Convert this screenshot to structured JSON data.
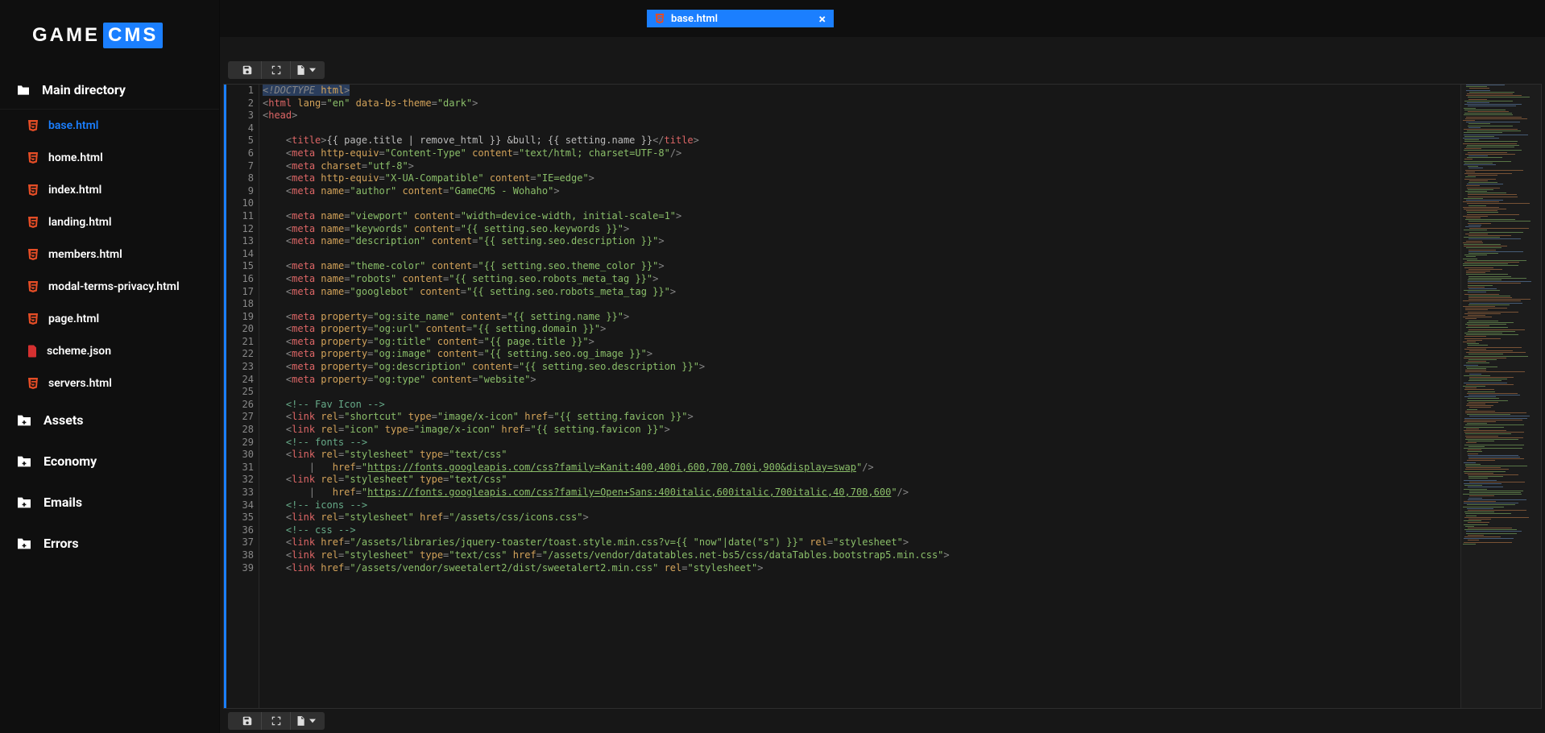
{
  "logo": {
    "part1": "GAME",
    "part2": "CMS"
  },
  "tree_header": "Main directory",
  "files": [
    {
      "name": "base.html",
      "type": "html",
      "active": true
    },
    {
      "name": "home.html",
      "type": "html"
    },
    {
      "name": "index.html",
      "type": "html"
    },
    {
      "name": "landing.html",
      "type": "html"
    },
    {
      "name": "members.html",
      "type": "html"
    },
    {
      "name": "modal-terms-privacy.html",
      "type": "html"
    },
    {
      "name": "page.html",
      "type": "html"
    },
    {
      "name": "scheme.json",
      "type": "json"
    },
    {
      "name": "servers.html",
      "type": "html"
    }
  ],
  "folders": [
    "Assets",
    "Economy",
    "Emails",
    "Errors"
  ],
  "tab": {
    "label": "base.html"
  },
  "code_lines": [
    {
      "n": 1,
      "indent": 0,
      "html": "<span class='t-sel'><span class='t-p'>&lt;</span><span class='t-doctype'>!DOCTYPE</span> <span class='t-attr'>html</span><span class='t-p'>&gt;</span></span>"
    },
    {
      "n": 2,
      "indent": 0,
      "html": "<span class='t-p'>&lt;</span><span class='t-tag'>html</span> <span class='t-attr'>lang</span><span class='t-p'>=</span><span class='t-str'>\"en\"</span> <span class='t-attr'>data-bs-theme</span><span class='t-p'>=</span><span class='t-str'>\"dark\"</span><span class='t-p'>&gt;</span>"
    },
    {
      "n": 3,
      "indent": 0,
      "html": "<span class='t-p'>&lt;</span><span class='t-tag'>head</span><span class='t-p'>&gt;</span>"
    },
    {
      "n": 4,
      "indent": 0,
      "html": ""
    },
    {
      "n": 5,
      "indent": 1,
      "html": "<span class='t-p'>&lt;</span><span class='t-tag'>title</span><span class='t-p'>&gt;</span>{{ page.title | remove_html }} &amp;bull; {{ setting.name }}<span class='t-p'>&lt;/</span><span class='t-tag'>title</span><span class='t-p'>&gt;</span>"
    },
    {
      "n": 6,
      "indent": 1,
      "html": "<span class='t-p'>&lt;</span><span class='t-tag'>meta</span> <span class='t-attr'>http-equiv</span><span class='t-p'>=</span><span class='t-str'>\"Content-Type\"</span> <span class='t-attr'>content</span><span class='t-p'>=</span><span class='t-str'>\"text/html; charset=UTF-8\"</span><span class='t-p'>/&gt;</span>"
    },
    {
      "n": 7,
      "indent": 1,
      "html": "<span class='t-p'>&lt;</span><span class='t-tag'>meta</span> <span class='t-attr'>charset</span><span class='t-p'>=</span><span class='t-str'>\"utf-8\"</span><span class='t-p'>&gt;</span>"
    },
    {
      "n": 8,
      "indent": 1,
      "html": "<span class='t-p'>&lt;</span><span class='t-tag'>meta</span> <span class='t-attr'>http-equiv</span><span class='t-p'>=</span><span class='t-str'>\"X-UA-Compatible\"</span> <span class='t-attr'>content</span><span class='t-p'>=</span><span class='t-str'>\"IE=edge\"</span><span class='t-p'>&gt;</span>"
    },
    {
      "n": 9,
      "indent": 1,
      "html": "<span class='t-p'>&lt;</span><span class='t-tag'>meta</span> <span class='t-attr'>name</span><span class='t-p'>=</span><span class='t-str'>\"author\"</span> <span class='t-attr'>content</span><span class='t-p'>=</span><span class='t-str'>\"GameCMS - Wohaho\"</span><span class='t-p'>&gt;</span>"
    },
    {
      "n": 10,
      "indent": 0,
      "html": ""
    },
    {
      "n": 11,
      "indent": 1,
      "html": "<span class='t-p'>&lt;</span><span class='t-tag'>meta</span> <span class='t-attr'>name</span><span class='t-p'>=</span><span class='t-str'>\"viewport\"</span> <span class='t-attr'>content</span><span class='t-p'>=</span><span class='t-str'>\"width=device-width, initial-scale=1\"</span><span class='t-p'>&gt;</span>"
    },
    {
      "n": 12,
      "indent": 1,
      "html": "<span class='t-p'>&lt;</span><span class='t-tag'>meta</span> <span class='t-attr'>name</span><span class='t-p'>=</span><span class='t-str'>\"keywords\"</span> <span class='t-attr'>content</span><span class='t-p'>=</span><span class='t-str'>\"{{ setting.seo.keywords }}\"</span><span class='t-p'>&gt;</span>"
    },
    {
      "n": 13,
      "indent": 1,
      "html": "<span class='t-p'>&lt;</span><span class='t-tag'>meta</span> <span class='t-attr'>name</span><span class='t-p'>=</span><span class='t-str'>\"description\"</span> <span class='t-attr'>content</span><span class='t-p'>=</span><span class='t-str'>\"{{ setting.seo.description }}\"</span><span class='t-p'>&gt;</span>"
    },
    {
      "n": 14,
      "indent": 0,
      "html": ""
    },
    {
      "n": 15,
      "indent": 1,
      "html": "<span class='t-p'>&lt;</span><span class='t-tag'>meta</span> <span class='t-attr'>name</span><span class='t-p'>=</span><span class='t-str'>\"theme-color\"</span> <span class='t-attr'>content</span><span class='t-p'>=</span><span class='t-str'>\"{{ setting.seo.theme_color }}\"</span><span class='t-p'>&gt;</span>"
    },
    {
      "n": 16,
      "indent": 1,
      "html": "<span class='t-p'>&lt;</span><span class='t-tag'>meta</span> <span class='t-attr'>name</span><span class='t-p'>=</span><span class='t-str'>\"robots\"</span> <span class='t-attr'>content</span><span class='t-p'>=</span><span class='t-str'>\"{{ setting.seo.robots_meta_tag }}\"</span><span class='t-p'>&gt;</span>"
    },
    {
      "n": 17,
      "indent": 1,
      "html": "<span class='t-p'>&lt;</span><span class='t-tag'>meta</span> <span class='t-attr'>name</span><span class='t-p'>=</span><span class='t-str'>\"googlebot\"</span> <span class='t-attr'>content</span><span class='t-p'>=</span><span class='t-str'>\"{{ setting.seo.robots_meta_tag }}\"</span><span class='t-p'>&gt;</span>"
    },
    {
      "n": 18,
      "indent": 0,
      "html": ""
    },
    {
      "n": 19,
      "indent": 1,
      "html": "<span class='t-p'>&lt;</span><span class='t-tag'>meta</span> <span class='t-attr'>property</span><span class='t-p'>=</span><span class='t-str'>\"og:site_name\"</span> <span class='t-attr'>content</span><span class='t-p'>=</span><span class='t-str'>\"{{ setting.name }}\"</span><span class='t-p'>&gt;</span>"
    },
    {
      "n": 20,
      "indent": 1,
      "html": "<span class='t-p'>&lt;</span><span class='t-tag'>meta</span> <span class='t-attr'>property</span><span class='t-p'>=</span><span class='t-str'>\"og:url\"</span> <span class='t-attr'>content</span><span class='t-p'>=</span><span class='t-str'>\"{{ setting.domain }}\"</span><span class='t-p'>&gt;</span>"
    },
    {
      "n": 21,
      "indent": 1,
      "html": "<span class='t-p'>&lt;</span><span class='t-tag'>meta</span> <span class='t-attr'>property</span><span class='t-p'>=</span><span class='t-str'>\"og:title\"</span> <span class='t-attr'>content</span><span class='t-p'>=</span><span class='t-str'>\"{{ page.title }}\"</span><span class='t-p'>&gt;</span>"
    },
    {
      "n": 22,
      "indent": 1,
      "html": "<span class='t-p'>&lt;</span><span class='t-tag'>meta</span> <span class='t-attr'>property</span><span class='t-p'>=</span><span class='t-str'>\"og:image\"</span> <span class='t-attr'>content</span><span class='t-p'>=</span><span class='t-str'>\"{{ setting.seo.og_image }}\"</span><span class='t-p'>&gt;</span>"
    },
    {
      "n": 23,
      "indent": 1,
      "html": "<span class='t-p'>&lt;</span><span class='t-tag'>meta</span> <span class='t-attr'>property</span><span class='t-p'>=</span><span class='t-str'>\"og:description\"</span> <span class='t-attr'>content</span><span class='t-p'>=</span><span class='t-str'>\"{{ setting.seo.description }}\"</span><span class='t-p'>&gt;</span>"
    },
    {
      "n": 24,
      "indent": 1,
      "html": "<span class='t-p'>&lt;</span><span class='t-tag'>meta</span> <span class='t-attr'>property</span><span class='t-p'>=</span><span class='t-str'>\"og:type\"</span> <span class='t-attr'>content</span><span class='t-p'>=</span><span class='t-str'>\"website\"</span><span class='t-p'>&gt;</span>"
    },
    {
      "n": 25,
      "indent": 0,
      "html": ""
    },
    {
      "n": 26,
      "indent": 1,
      "html": "<span class='t-com'>&lt;!-- Fav Icon --&gt;</span>"
    },
    {
      "n": 27,
      "indent": 1,
      "html": "<span class='t-p'>&lt;</span><span class='t-tag'>link</span> <span class='t-attr'>rel</span><span class='t-p'>=</span><span class='t-str'>\"shortcut\"</span> <span class='t-attr'>type</span><span class='t-p'>=</span><span class='t-str'>\"image/x-icon\"</span> <span class='t-attr'>href</span><span class='t-p'>=</span><span class='t-str'>\"{{ setting.favicon }}\"</span><span class='t-p'>&gt;</span>"
    },
    {
      "n": 28,
      "indent": 1,
      "html": "<span class='t-p'>&lt;</span><span class='t-tag'>link</span> <span class='t-attr'>rel</span><span class='t-p'>=</span><span class='t-str'>\"icon\"</span> <span class='t-attr'>type</span><span class='t-p'>=</span><span class='t-str'>\"image/x-icon\"</span> <span class='t-attr'>href</span><span class='t-p'>=</span><span class='t-str'>\"{{ setting.favicon }}\"</span><span class='t-p'>&gt;</span>"
    },
    {
      "n": 29,
      "indent": 1,
      "html": "<span class='t-com'>&lt;!-- fonts --&gt;</span>"
    },
    {
      "n": 30,
      "indent": 1,
      "html": "<span class='t-p'>&lt;</span><span class='t-tag'>link</span> <span class='t-attr'>rel</span><span class='t-p'>=</span><span class='t-str'>\"stylesheet\"</span> <span class='t-attr'>type</span><span class='t-p'>=</span><span class='t-str'>\"text/css\"</span>"
    },
    {
      "n": 31,
      "indent": 2,
      "html": "<span class='t-p'>|</span>   <span class='t-attr'>href</span><span class='t-p'>=</span><span class='t-str'>\"</span><span class='t-url'>https://fonts.googleapis.com/css?family=Kanit:400,400i,600,700,700i,900&amp;display=swap</span><span class='t-str'>\"</span><span class='t-p'>/&gt;</span>"
    },
    {
      "n": 32,
      "indent": 1,
      "html": "<span class='t-p'>&lt;</span><span class='t-tag'>link</span> <span class='t-attr'>rel</span><span class='t-p'>=</span><span class='t-str'>\"stylesheet\"</span> <span class='t-attr'>type</span><span class='t-p'>=</span><span class='t-str'>\"text/css\"</span>"
    },
    {
      "n": 33,
      "indent": 2,
      "html": "<span class='t-p'>|</span>   <span class='t-attr'>href</span><span class='t-p'>=</span><span class='t-str'>\"</span><span class='t-url'>https://fonts.googleapis.com/css?family=Open+Sans:400italic,600italic,700italic,40,700,600</span><span class='t-str'>\"</span><span class='t-p'>/&gt;</span>"
    },
    {
      "n": 34,
      "indent": 1,
      "html": "<span class='t-com'>&lt;!-- icons --&gt;</span>"
    },
    {
      "n": 35,
      "indent": 1,
      "html": "<span class='t-p'>&lt;</span><span class='t-tag'>link</span> <span class='t-attr'>rel</span><span class='t-p'>=</span><span class='t-str'>\"stylesheet\"</span> <span class='t-attr'>href</span><span class='t-p'>=</span><span class='t-str'>\"/assets/css/icons.css\"</span><span class='t-p'>&gt;</span>"
    },
    {
      "n": 36,
      "indent": 1,
      "html": "<span class='t-com'>&lt;!-- css --&gt;</span>"
    },
    {
      "n": 37,
      "indent": 1,
      "html": "<span class='t-p'>&lt;</span><span class='t-tag'>link</span> <span class='t-attr'>href</span><span class='t-p'>=</span><span class='t-str'>\"/assets/libraries/jquery-toaster/toast.style.min.css?v={{ \"now\"|date(\"s\") }}\"</span> <span class='t-attr'>rel</span><span class='t-p'>=</span><span class='t-str'>\"stylesheet\"</span><span class='t-p'>&gt;</span>"
    },
    {
      "n": 38,
      "indent": 1,
      "html": "<span class='t-p'>&lt;</span><span class='t-tag'>link</span> <span class='t-attr'>rel</span><span class='t-p'>=</span><span class='t-str'>\"stylesheet\"</span> <span class='t-attr'>type</span><span class='t-p'>=</span><span class='t-str'>\"text/css\"</span> <span class='t-attr'>href</span><span class='t-p'>=</span><span class='t-str'>\"/assets/vendor/datatables.net-bs5/css/dataTables.bootstrap5.min.css\"</span><span class='t-p'>&gt;</span>"
    },
    {
      "n": 39,
      "indent": 1,
      "html": "<span class='t-p'>&lt;</span><span class='t-tag'>link</span> <span class='t-attr'>href</span><span class='t-p'>=</span><span class='t-str'>\"/assets/vendor/sweetalert2/dist/sweetalert2.min.css\"</span> <span class='t-attr'>rel</span><span class='t-p'>=</span><span class='t-str'>\"stylesheet\"</span><span class='t-p'>&gt;</span>"
    }
  ],
  "minimap_colors": [
    "#c5804b",
    "#8bbf6a",
    "#6a8fc1",
    "#8bbf6a",
    "#c5804b",
    "#8bbf6a",
    "#c5804b"
  ]
}
